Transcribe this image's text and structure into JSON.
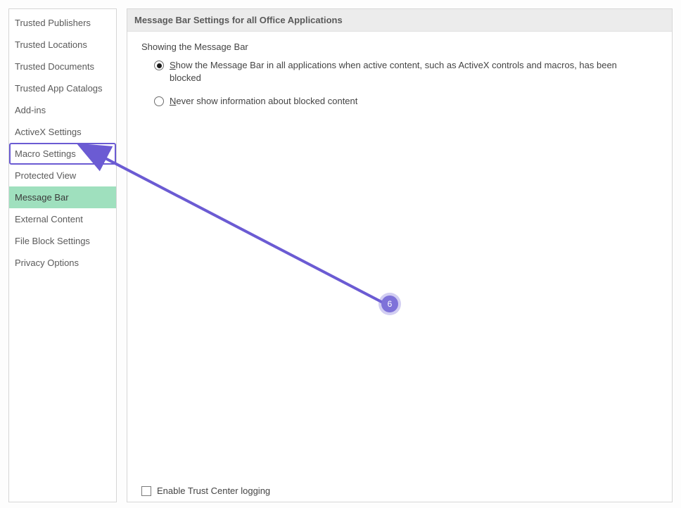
{
  "sidebar": {
    "items": [
      {
        "label": "Trusted Publishers"
      },
      {
        "label": "Trusted Locations"
      },
      {
        "label": "Trusted Documents"
      },
      {
        "label": "Trusted App Catalogs"
      },
      {
        "label": "Add-ins"
      },
      {
        "label": "ActiveX Settings"
      },
      {
        "label": "Macro Settings"
      },
      {
        "label": "Protected View"
      },
      {
        "label": "Message Bar"
      },
      {
        "label": "External Content"
      },
      {
        "label": "File Block Settings"
      },
      {
        "label": "Privacy Options"
      }
    ],
    "selected_index": 8,
    "highlighted_index": 6
  },
  "content": {
    "header": "Message Bar Settings for all Office Applications",
    "group_title": "Showing the Message Bar",
    "radios": [
      {
        "accel": "S",
        "text": "how the Message Bar in all applications when active content, such as ActiveX controls and macros, has been blocked",
        "checked": true
      },
      {
        "accel": "N",
        "text": "ever show information about blocked content",
        "checked": false
      }
    ],
    "footer": {
      "checkbox_label": "Enable Trust Center logging",
      "checked": false
    }
  },
  "annotation": {
    "badge_number": "6",
    "colors": {
      "arrow": "#6b5bd3",
      "badge": "#7e72d9"
    }
  }
}
